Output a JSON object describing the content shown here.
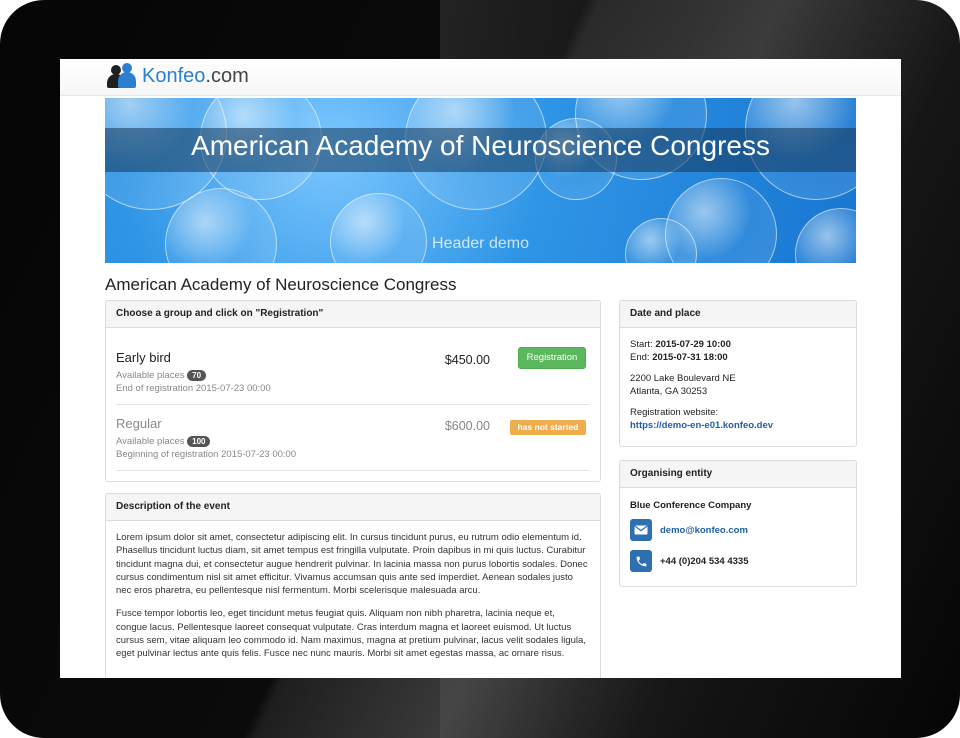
{
  "site": {
    "logo_name": "Konfeo",
    "logo_domain": ".com"
  },
  "banner": {
    "title": "American Academy of Neuroscience Congress",
    "subtitle": "Header demo"
  },
  "event": {
    "title": "American Academy of Neuroscience Congress"
  },
  "registration": {
    "heading": "Choose a group and click on \"Registration\"",
    "groups": [
      {
        "name": "Early bird",
        "available_label": "Available places",
        "available_count": "70",
        "date_text": "End of registration 2015-07-23 00:00",
        "price": "$450.00",
        "action": "Registration"
      },
      {
        "name": "Regular",
        "available_label": "Available places",
        "available_count": "100",
        "date_text": "Beginning of registration 2015-07-23 00:00",
        "price": "$600.00",
        "status": "has not started"
      }
    ]
  },
  "description": {
    "heading": "Description of the event",
    "paragraphs": [
      "Lorem ipsum dolor sit amet, consectetur adipiscing elit. In cursus tincidunt purus, eu rutrum odio elementum id. Phasellus tincidunt luctus diam, sit amet tempus est fringilla vulputate. Proin dapibus in mi quis luctus. Curabitur tincidunt magna dui, et consectetur augue hendrerit pulvinar. In lacinia massa non purus lobortis sodales. Donec cursus condimentum nisl sit amet efficitur. Vivamus accumsan quis ante sed imperdiet. Aenean sodales justo nec eros pharetra, eu pellentesque nisl fermentum. Morbi scelerisque malesuada arcu.",
      "Fusce tempor lobortis leo, eget tincidunt metus feugiat quis. Aliquam non nibh pharetra, lacinia neque et, congue lacus. Pellentesque laoreet consequat vulputate. Cras interdum magna et laoreet euismod. Ut luctus cursus sem, vitae aliquam leo commodo id. Nam maximus, magna at pretium pulvinar, lacus velit sodales ligula, eget pulvinar lectus ante quis felis. Fusce nec nunc mauris. Morbi sit amet egestas massa, ac ornare risus."
    ]
  },
  "date_place": {
    "heading": "Date and place",
    "start_label": "Start:",
    "start_value": "2015-07-29 10:00",
    "end_label": "End:",
    "end_value": "2015-07-31 18:00",
    "address_line1": "2200 Lake Boulevard NE",
    "address_line2": "Atlanta, GA 30253",
    "website_label": "Registration website:",
    "website_url": "https://demo-en-e01.konfeo.dev"
  },
  "organiser": {
    "heading": "Organising entity",
    "name": "Blue Conference Company",
    "email": "demo@konfeo.com",
    "phone": "+44 (0)204 534 4335"
  },
  "colors": {
    "brand_blue": "#2b7fd0",
    "success_green": "#5cb85c",
    "warning_orange": "#f0ad4e",
    "link_blue": "#1e5fa8"
  }
}
